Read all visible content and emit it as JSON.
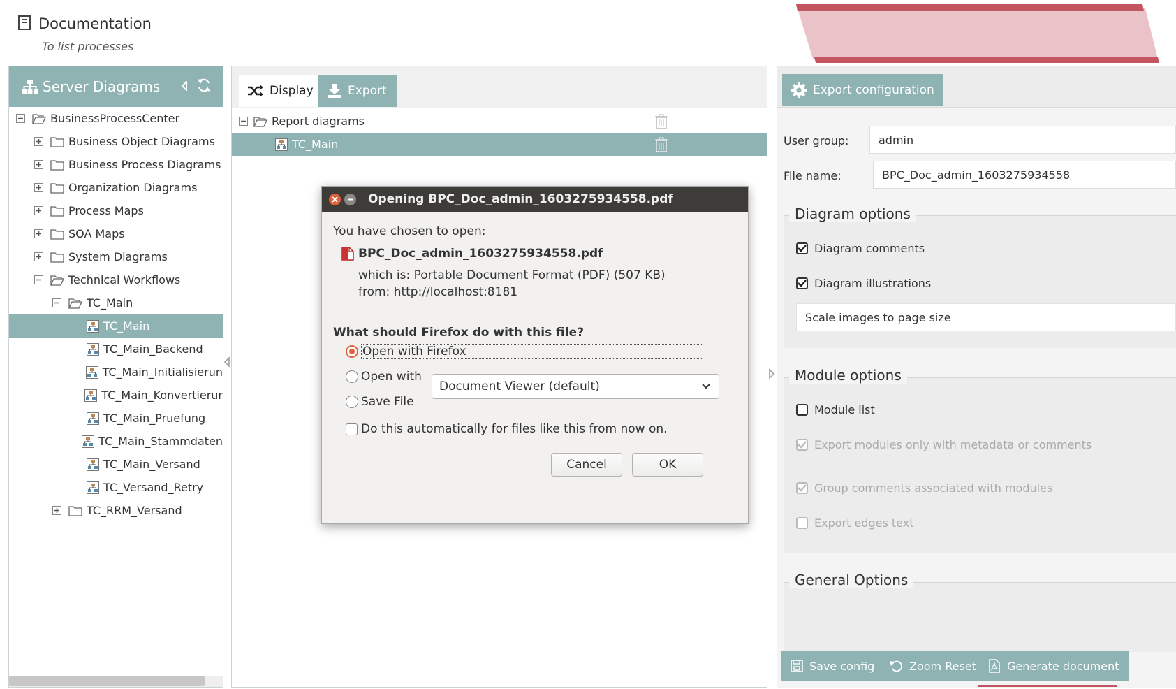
{
  "header": {
    "title": "Documentation",
    "subtitle": "To list processes"
  },
  "left_panel": {
    "title": "Server Diagrams",
    "tree": [
      {
        "label": "BusinessProcessCenter",
        "level": 0,
        "toggle": "minus",
        "icon": "folder-open-icon",
        "selected": false
      },
      {
        "label": "Business Object Diagrams",
        "level": 1,
        "toggle": "plus",
        "icon": "folder-icon",
        "selected": false
      },
      {
        "label": "Business Process Diagrams",
        "level": 1,
        "toggle": "plus",
        "icon": "folder-icon",
        "selected": false
      },
      {
        "label": "Organization Diagrams",
        "level": 1,
        "toggle": "plus",
        "icon": "folder-icon",
        "selected": false
      },
      {
        "label": "Process Maps",
        "level": 1,
        "toggle": "plus",
        "icon": "folder-icon",
        "selected": false
      },
      {
        "label": "SOA Maps",
        "level": 1,
        "toggle": "plus",
        "icon": "folder-icon",
        "selected": false
      },
      {
        "label": "System Diagrams",
        "level": 1,
        "toggle": "plus",
        "icon": "folder-icon",
        "selected": false
      },
      {
        "label": "Technical Workflows",
        "level": 1,
        "toggle": "minus",
        "icon": "folder-open-icon",
        "selected": false
      },
      {
        "label": "TC_Main",
        "level": 2,
        "toggle": "minus",
        "icon": "folder-open-icon",
        "selected": false
      },
      {
        "label": "TC_Main",
        "level": 3,
        "toggle": "none",
        "icon": "diagram-icon",
        "selected": true
      },
      {
        "label": "TC_Main_Backend",
        "level": 3,
        "toggle": "none",
        "icon": "diagram-icon",
        "selected": false
      },
      {
        "label": "TC_Main_Initialisierun",
        "level": 3,
        "toggle": "none",
        "icon": "diagram-icon",
        "selected": false
      },
      {
        "label": "TC_Main_Konvertierur",
        "level": 3,
        "toggle": "none",
        "icon": "diagram-icon",
        "selected": false
      },
      {
        "label": "TC_Main_Pruefung",
        "level": 3,
        "toggle": "none",
        "icon": "diagram-icon",
        "selected": false
      },
      {
        "label": "TC_Main_Stammdaten",
        "level": 3,
        "toggle": "none",
        "icon": "diagram-icon",
        "selected": false
      },
      {
        "label": "TC_Main_Versand",
        "level": 3,
        "toggle": "none",
        "icon": "diagram-icon",
        "selected": false
      },
      {
        "label": "TC_Versand_Retry",
        "level": 3,
        "toggle": "none",
        "icon": "diagram-icon",
        "selected": false
      },
      {
        "label": "TC_RRM_Versand",
        "level": 2,
        "toggle": "plus",
        "icon": "folder-icon",
        "selected": false
      }
    ]
  },
  "middle_panel": {
    "tabs": [
      {
        "label": "Display",
        "active": false
      },
      {
        "label": "Export",
        "active": true
      }
    ],
    "report_folder": "Report diagrams",
    "report_item": "TC_Main"
  },
  "right_panel": {
    "tab_label": "Export configuration",
    "user_group_label": "User group:",
    "user_group_value": "admin",
    "file_name_label": "File name:",
    "file_name_value": "BPC_Doc_admin_1603275934558",
    "diagram_options": {
      "legend": "Diagram options",
      "comments": {
        "label": "Diagram comments",
        "checked": true
      },
      "illustrations": {
        "label": "Diagram illustrations",
        "checked": true
      },
      "scale_select": "Scale images to page size"
    },
    "module_options": {
      "legend": "Module options",
      "module_list": {
        "label": "Module list",
        "checked": false
      },
      "export_meta": {
        "label": "Export modules only with metadata or comments",
        "checked": true
      },
      "group_comments": {
        "label": "Group comments associated with modules",
        "checked": true
      },
      "edges_text": {
        "label": "Export edges text",
        "checked": false
      }
    },
    "general_options": {
      "legend": "General Options"
    },
    "buttons": {
      "save": "Save config",
      "zoom": "Zoom Reset",
      "generate": "Generate document"
    }
  },
  "dialog": {
    "title": "Opening BPC_Doc_admin_1603275934558.pdf",
    "chosen_text": "You have chosen to open:",
    "file_name": "BPC_Doc_admin_1603275934558.pdf",
    "which_is": "which is: Portable Document Format (PDF) (507 KB)",
    "from": "from: http://localhost:8181",
    "question": "What should Firefox do with this file?",
    "options": {
      "open_firefox": "Open with Firefox",
      "open_with": "Open with",
      "save_file": "Save File"
    },
    "selected_option": "open_firefox",
    "viewer_select": "Document Viewer (default)",
    "auto_checkbox": "Do this automatically for files like this from now on.",
    "cancel": "Cancel",
    "ok": "OK"
  },
  "colors": {
    "accent": "#8fb2b2",
    "brand_red": "#c25560",
    "brand_pink": "#e9c3c8",
    "dialog_title_bg": "#3d3c38",
    "radio_orange": "#e0613a"
  }
}
